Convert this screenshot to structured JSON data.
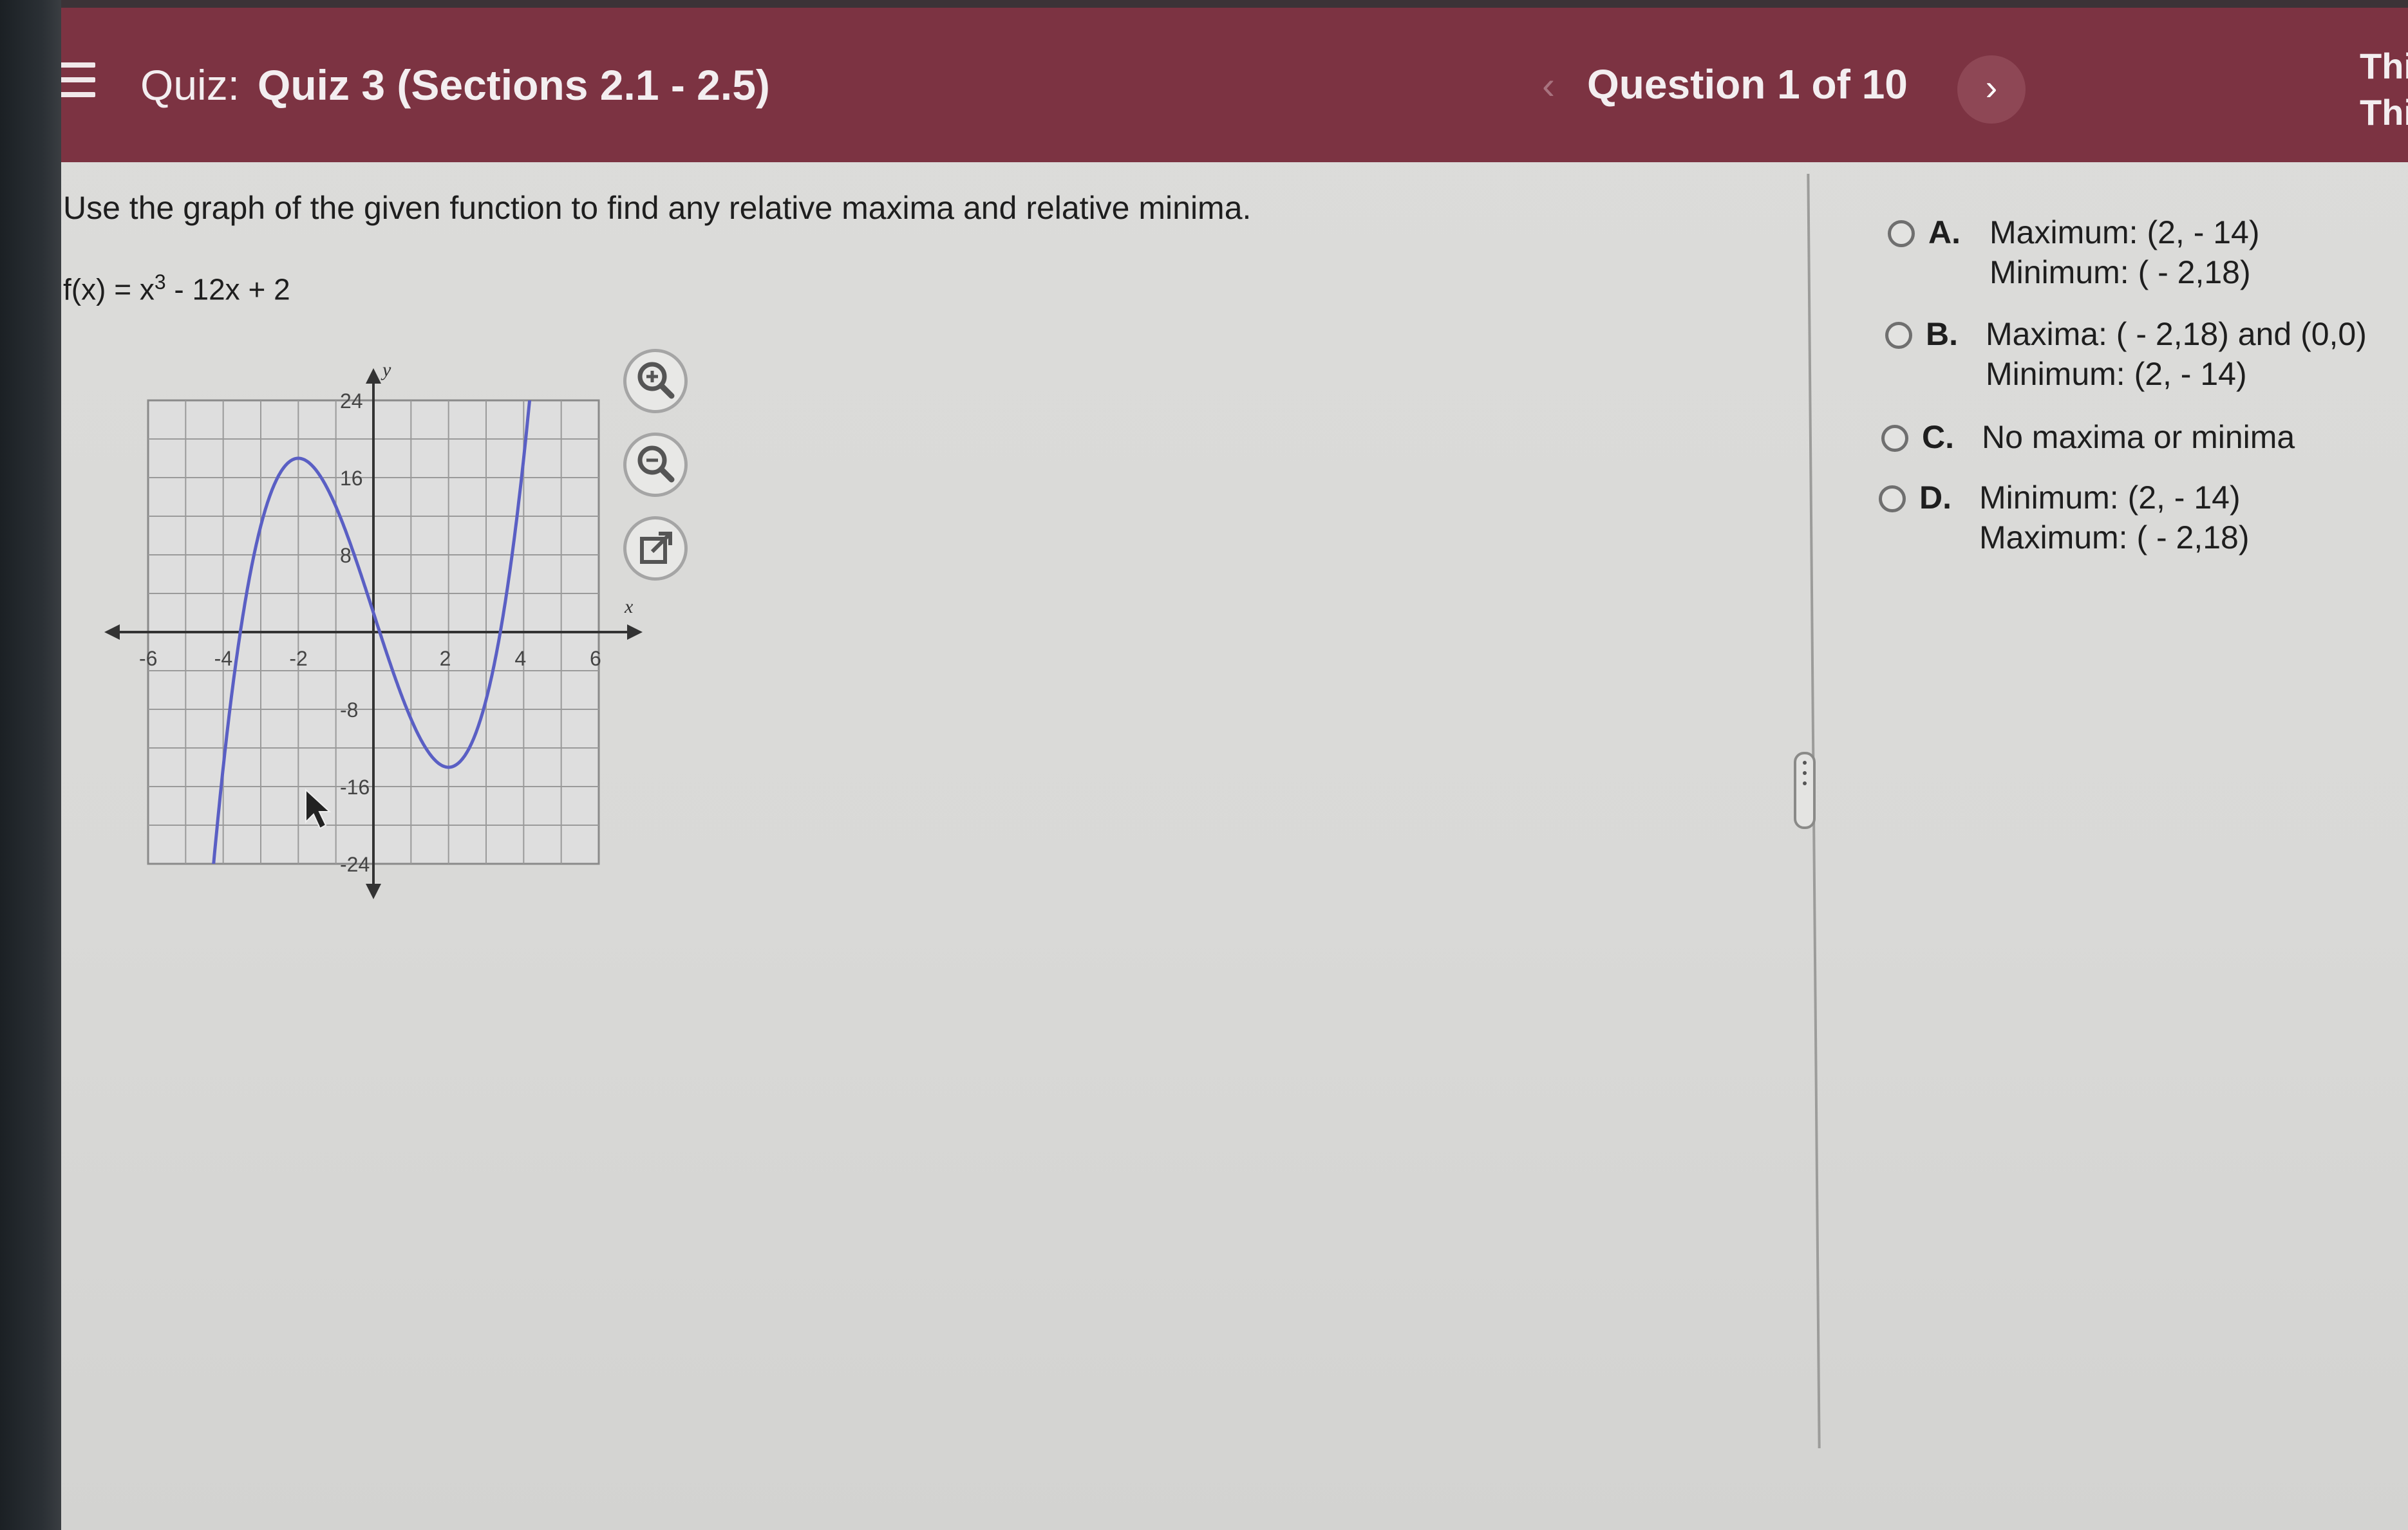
{
  "header": {
    "quiz_prefix": "Quiz:",
    "quiz_title": "Quiz 3 (Sections 2.1 - 2.5)",
    "prev_symbol": "‹",
    "question_counter": "Question 1 of 10",
    "next_symbol": "›",
    "right_line1": "Thi",
    "right_line2": "Thi"
  },
  "question": {
    "prompt": "Use the graph of the given function to find any relative maxima and relative minima.",
    "function_label": "f(x) = x",
    "function_exponent": "3",
    "function_rest": " - 12x + 2"
  },
  "graph": {
    "x_axis_label": "x",
    "y_axis_label": "y",
    "x_ticks": [
      "-6",
      "-4",
      "-2",
      "2",
      "4",
      "6"
    ],
    "y_ticks": [
      "24",
      "16",
      "8",
      "-8",
      "-16",
      "-24"
    ],
    "curve_color": "#5a5fc4",
    "function": "x^3 - 12x + 2",
    "x_range": [
      -6,
      6
    ],
    "y_range": [
      -24,
      24
    ],
    "grid_step": 1,
    "label_step": 2
  },
  "tools": {
    "zoom_in": "zoom-in-icon",
    "zoom_out": "zoom-out-icon",
    "popout": "popout-icon"
  },
  "options": [
    {
      "letter": "A.",
      "line1": "Maximum: (2, - 14)",
      "line2": "Minimum: ( - 2,18)"
    },
    {
      "letter": "B.",
      "line1": "Maxima: ( - 2,18) and (0,0)",
      "line2": "Minimum: (2, - 14)"
    },
    {
      "letter": "C.",
      "line1": "No maxima or minima",
      "line2": ""
    },
    {
      "letter": "D.",
      "line1": "Minimum: (2, - 14)",
      "line2": "Maximum: ( - 2,18)"
    }
  ]
}
